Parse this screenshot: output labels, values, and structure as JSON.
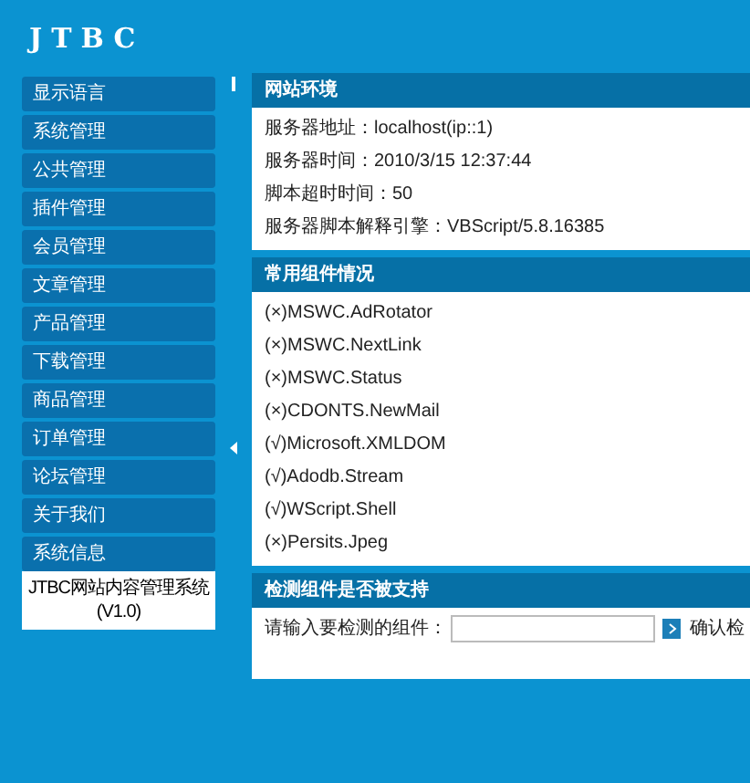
{
  "logo": "JTBC",
  "sidebar": {
    "items": [
      {
        "label": "显示语言"
      },
      {
        "label": "系统管理"
      },
      {
        "label": "公共管理"
      },
      {
        "label": "插件管理"
      },
      {
        "label": "会员管理"
      },
      {
        "label": "文章管理"
      },
      {
        "label": "产品管理"
      },
      {
        "label": "下载管理"
      },
      {
        "label": "商品管理"
      },
      {
        "label": "订单管理"
      },
      {
        "label": "论坛管理"
      },
      {
        "label": "关于我们"
      },
      {
        "label": "系统信息"
      }
    ],
    "footer": [
      "JTBC网站内容管理系统",
      "(V1.0)"
    ]
  },
  "panels": [
    {
      "kind": "info",
      "title": "网站环境",
      "lines": [
        "服务器地址：localhost(ip::1)",
        "服务器时间：2010/3/15 12:37:44",
        "脚本超时时间：50",
        "服务器脚本解释引擎：VBScript/5.8.16385"
      ]
    },
    {
      "kind": "info",
      "title": "常用组件情况",
      "lines": [
        "(×)MSWC.AdRotator",
        "(×)MSWC.NextLink",
        "(×)MSWC.Status",
        "(×)CDONTS.NewMail",
        "(√)Microsoft.XMLDOM",
        "(√)Adodb.Stream",
        "(√)WScript.Shell",
        "(×)Persits.Jpeg"
      ]
    },
    {
      "kind": "form",
      "title": "检测组件是否被支持",
      "label": "请输入要检测的组件：",
      "button": "确认检"
    }
  ]
}
